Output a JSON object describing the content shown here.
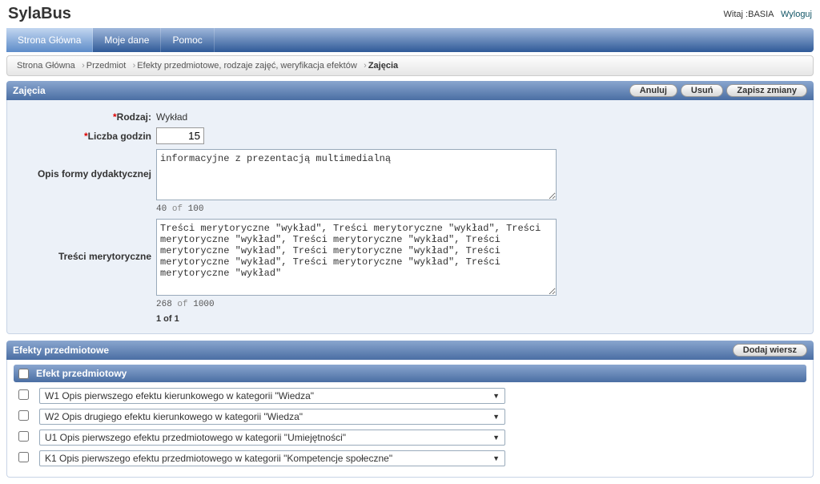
{
  "app_title": "SylaBus",
  "user": {
    "welcome_prefix": "Witaj :",
    "name": "BASIA",
    "logout": "Wyloguj"
  },
  "tabs": [
    {
      "label": "Strona Główna",
      "active": true
    },
    {
      "label": "Moje dane",
      "active": false
    },
    {
      "label": "Pomoc",
      "active": false
    }
  ],
  "breadcrumb": [
    {
      "label": "Strona Główna"
    },
    {
      "label": "Przedmiot"
    },
    {
      "label": "Efekty przedmiotowe, rodzaje zajęć, weryfikacja efektów"
    },
    {
      "label": "Zajęcia",
      "current": true
    }
  ],
  "zajecia": {
    "title": "Zajęcia",
    "buttons": {
      "cancel": "Anuluj",
      "delete": "Usuń",
      "save": "Zapisz zmiany"
    },
    "fields": {
      "rodzaj_label": "Rodzaj:",
      "rodzaj_value": "Wykład",
      "liczba_label": "Liczba godzin",
      "liczba_value": "15",
      "opis_label": "Opis formy dydaktycznej",
      "opis_value": "informacyjne z prezentacją multimedialną",
      "opis_counter": {
        "n": "40",
        "of": "of",
        "max": "100"
      },
      "tresci_label": "Treści merytoryczne",
      "tresci_value": "Treści merytoryczne \"wykład\", Treści merytoryczne \"wykład\", Treści merytoryczne \"wykład\", Treści merytoryczne \"wykład\", Treści merytoryczne \"wykład\", Treści merytoryczne \"wykład\", Treści merytoryczne \"wykład\", Treści merytoryczne \"wykład\", Treści merytoryczne \"wykład\"",
      "tresci_counter": {
        "n": "268",
        "of": "of",
        "max": "1000"
      },
      "pager": "1 of 1"
    }
  },
  "efekty": {
    "title": "Efekty przedmiotowe",
    "add": "Dodaj wiersz",
    "header": "Efekt przedmiotowy",
    "rows": [
      {
        "text": "W1 Opis pierwszego efektu kierunkowego w kategorii \"Wiedza\""
      },
      {
        "text": "W2 Opis drugiego efektu kierunkowego w kategorii \"Wiedza\""
      },
      {
        "text": "U1 Opis pierwszego efektu przedmiotowego w kategorii \"Umiejętności\""
      },
      {
        "text": "K1 Opis pierwszego efektu przedmiotowego w kategorii \"Kompetencje społeczne\""
      }
    ]
  }
}
